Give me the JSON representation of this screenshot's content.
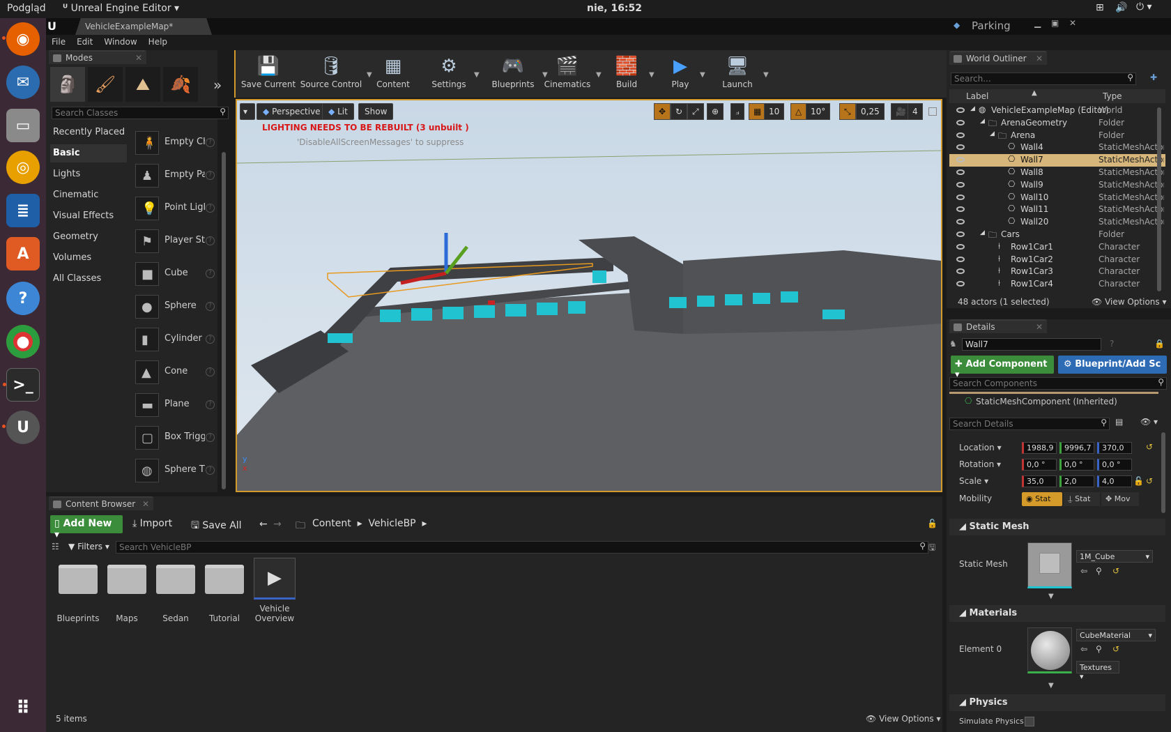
{
  "topbar": {
    "app": "Podgląd",
    "window_title": "Unreal Engine Editor",
    "clock": "nie, 16:52"
  },
  "titlebar": {
    "tab": "VehicleExampleMap*",
    "project": "Parking"
  },
  "menu": [
    "File",
    "Edit",
    "Window",
    "Help"
  ],
  "modes": {
    "tab": "Modes",
    "search_placeholder": "Search Classes",
    "categories": [
      "Recently Placed",
      "Basic",
      "Lights",
      "Cinematic",
      "Visual Effects",
      "Geometry",
      "Volumes",
      "All Classes"
    ],
    "selected_category": "Basic",
    "items": [
      "Empty Ch",
      "Empty Pa",
      "Point Ligl",
      "Player St",
      "Cube",
      "Sphere",
      "Cylinder",
      "Cone",
      "Plane",
      "Box Trigg",
      "Sphere T"
    ]
  },
  "toolbar": {
    "buttons": [
      "Save Current",
      "Source Control",
      "Content",
      "Settings",
      "Blueprints",
      "Cinematics",
      "Build",
      "Play",
      "Launch"
    ]
  },
  "viewport": {
    "perspective": "Perspective",
    "lit": "Lit",
    "show": "Show",
    "warning": "LIGHTING NEEDS TO BE REBUILT (3 unbuilt )",
    "hint": "'DisableAllScreenMessages' to suppress",
    "grid_snap": "10",
    "rot_snap": "10°",
    "scale_snap": "0,25",
    "cam_speed": "4"
  },
  "outliner": {
    "tab": "World Outliner",
    "search_placeholder": "Search...",
    "col_label": "Label",
    "col_type": "Type",
    "rows": [
      {
        "label": "VehicleExampleMap (Editor)",
        "type": "World",
        "indent": 0
      },
      {
        "label": "ArenaGeometry",
        "type": "Folder",
        "indent": 1
      },
      {
        "label": "Arena",
        "type": "Folder",
        "indent": 2
      },
      {
        "label": "Wall4",
        "type": "StaticMeshActor",
        "indent": 3
      },
      {
        "label": "Wall7",
        "type": "StaticMeshActor",
        "indent": 3
      },
      {
        "label": "Wall8",
        "type": "StaticMeshActor",
        "indent": 3
      },
      {
        "label": "Wall9",
        "type": "StaticMeshActor",
        "indent": 3
      },
      {
        "label": "Wall10",
        "type": "StaticMeshActor",
        "indent": 3
      },
      {
        "label": "Wall11",
        "type": "StaticMeshActor",
        "indent": 3
      },
      {
        "label": "Wall20",
        "type": "StaticMeshActor",
        "indent": 3
      },
      {
        "label": "Cars",
        "type": "Folder",
        "indent": 1
      },
      {
        "label": "Row1Car1",
        "type": "Character",
        "indent": 2
      },
      {
        "label": "Row1Car2",
        "type": "Character",
        "indent": 2
      },
      {
        "label": "Row1Car3",
        "type": "Character",
        "indent": 2
      },
      {
        "label": "Row1Car4",
        "type": "Character",
        "indent": 2
      }
    ],
    "selected": "Wall7",
    "status": "48 actors (1 selected)",
    "view_options": "View Options"
  },
  "details": {
    "tab": "Details",
    "name": "Wall7",
    "add_component": "Add Component",
    "blueprint": "Blueprint/Add Sc",
    "search_components": "Search Components",
    "component": "StaticMeshComponent (Inherited)",
    "search_details": "Search Details",
    "location_label": "Location",
    "location": [
      "1988,9",
      "9996,7",
      "370,0"
    ],
    "rotation_label": "Rotation",
    "rotation": [
      "0,0 °",
      "0,0 °",
      "0,0 °"
    ],
    "scale_label": "Scale",
    "scale": [
      "35,0",
      "2,0",
      "4,0"
    ],
    "mobility_label": "Mobility",
    "mobility": [
      "Stat",
      "Stat",
      "Mov"
    ],
    "static_mesh_section": "Static Mesh",
    "static_mesh_label": "Static Mesh",
    "static_mesh": "1M_Cube",
    "materials_section": "Materials",
    "element_label": "Element 0",
    "material": "CubeMaterial",
    "textures": "Textures",
    "physics_section": "Physics",
    "simulate_physics": "Simulate Physics"
  },
  "content_browser": {
    "tab": "Content Browser",
    "add_new": "Add New",
    "import": "Import",
    "save_all": "Save All",
    "path": [
      "Content",
      "VehicleBP"
    ],
    "filters": "Filters",
    "search_placeholder": "Search VehicleBP",
    "items": [
      "Blueprints",
      "Maps",
      "Sedan",
      "Tutorial",
      "Vehicle Overview"
    ],
    "count": "5 items",
    "view_options": "View Options"
  }
}
